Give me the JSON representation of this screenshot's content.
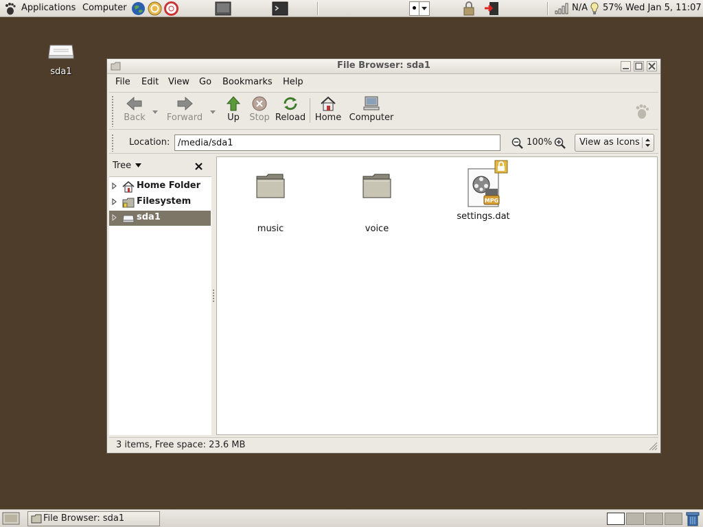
{
  "top_panel": {
    "applications_label": "Applications",
    "computer_label": "Computer",
    "network_status": "N/A",
    "battery_percent": "57%",
    "clock": "Wed Jan  5, 11:07"
  },
  "desktop": {
    "icons": [
      {
        "label": "sda1",
        "icon": "drive-icon"
      }
    ]
  },
  "window": {
    "title": "File Browser: sda1",
    "menu": [
      "File",
      "Edit",
      "View",
      "Go",
      "Bookmarks",
      "Help"
    ],
    "toolbar": {
      "back_label": "Back",
      "forward_label": "Forward",
      "up_label": "Up",
      "stop_label": "Stop",
      "reload_label": "Reload",
      "home_label": "Home",
      "computer_label": "Computer"
    },
    "location": {
      "label": "Location:",
      "value": "/media/sda1",
      "zoom": "100%",
      "view_mode": "View as Icons"
    },
    "sidebar": {
      "mode": "Tree",
      "items": [
        {
          "label": "Home Folder",
          "icon": "home-icon",
          "selected": false
        },
        {
          "label": "Filesystem",
          "icon": "filesystem-icon",
          "selected": false
        },
        {
          "label": "sda1",
          "icon": "drive-icon",
          "selected": true
        }
      ]
    },
    "files": [
      {
        "name": "music",
        "type": "folder"
      },
      {
        "name": "voice",
        "type": "folder"
      },
      {
        "name": "settings.dat",
        "type": "video-mpg",
        "emblem": "readonly-lock"
      }
    ],
    "status": "3 items, Free space: 23.6 MB"
  },
  "bottom_panel": {
    "task_label": "File Browser: sda1",
    "workspaces": 4,
    "active_workspace": 1
  },
  "colors": {
    "desktop": "#4e3d2b",
    "selection": "#7d7666",
    "panel": "#dcd8d1"
  }
}
